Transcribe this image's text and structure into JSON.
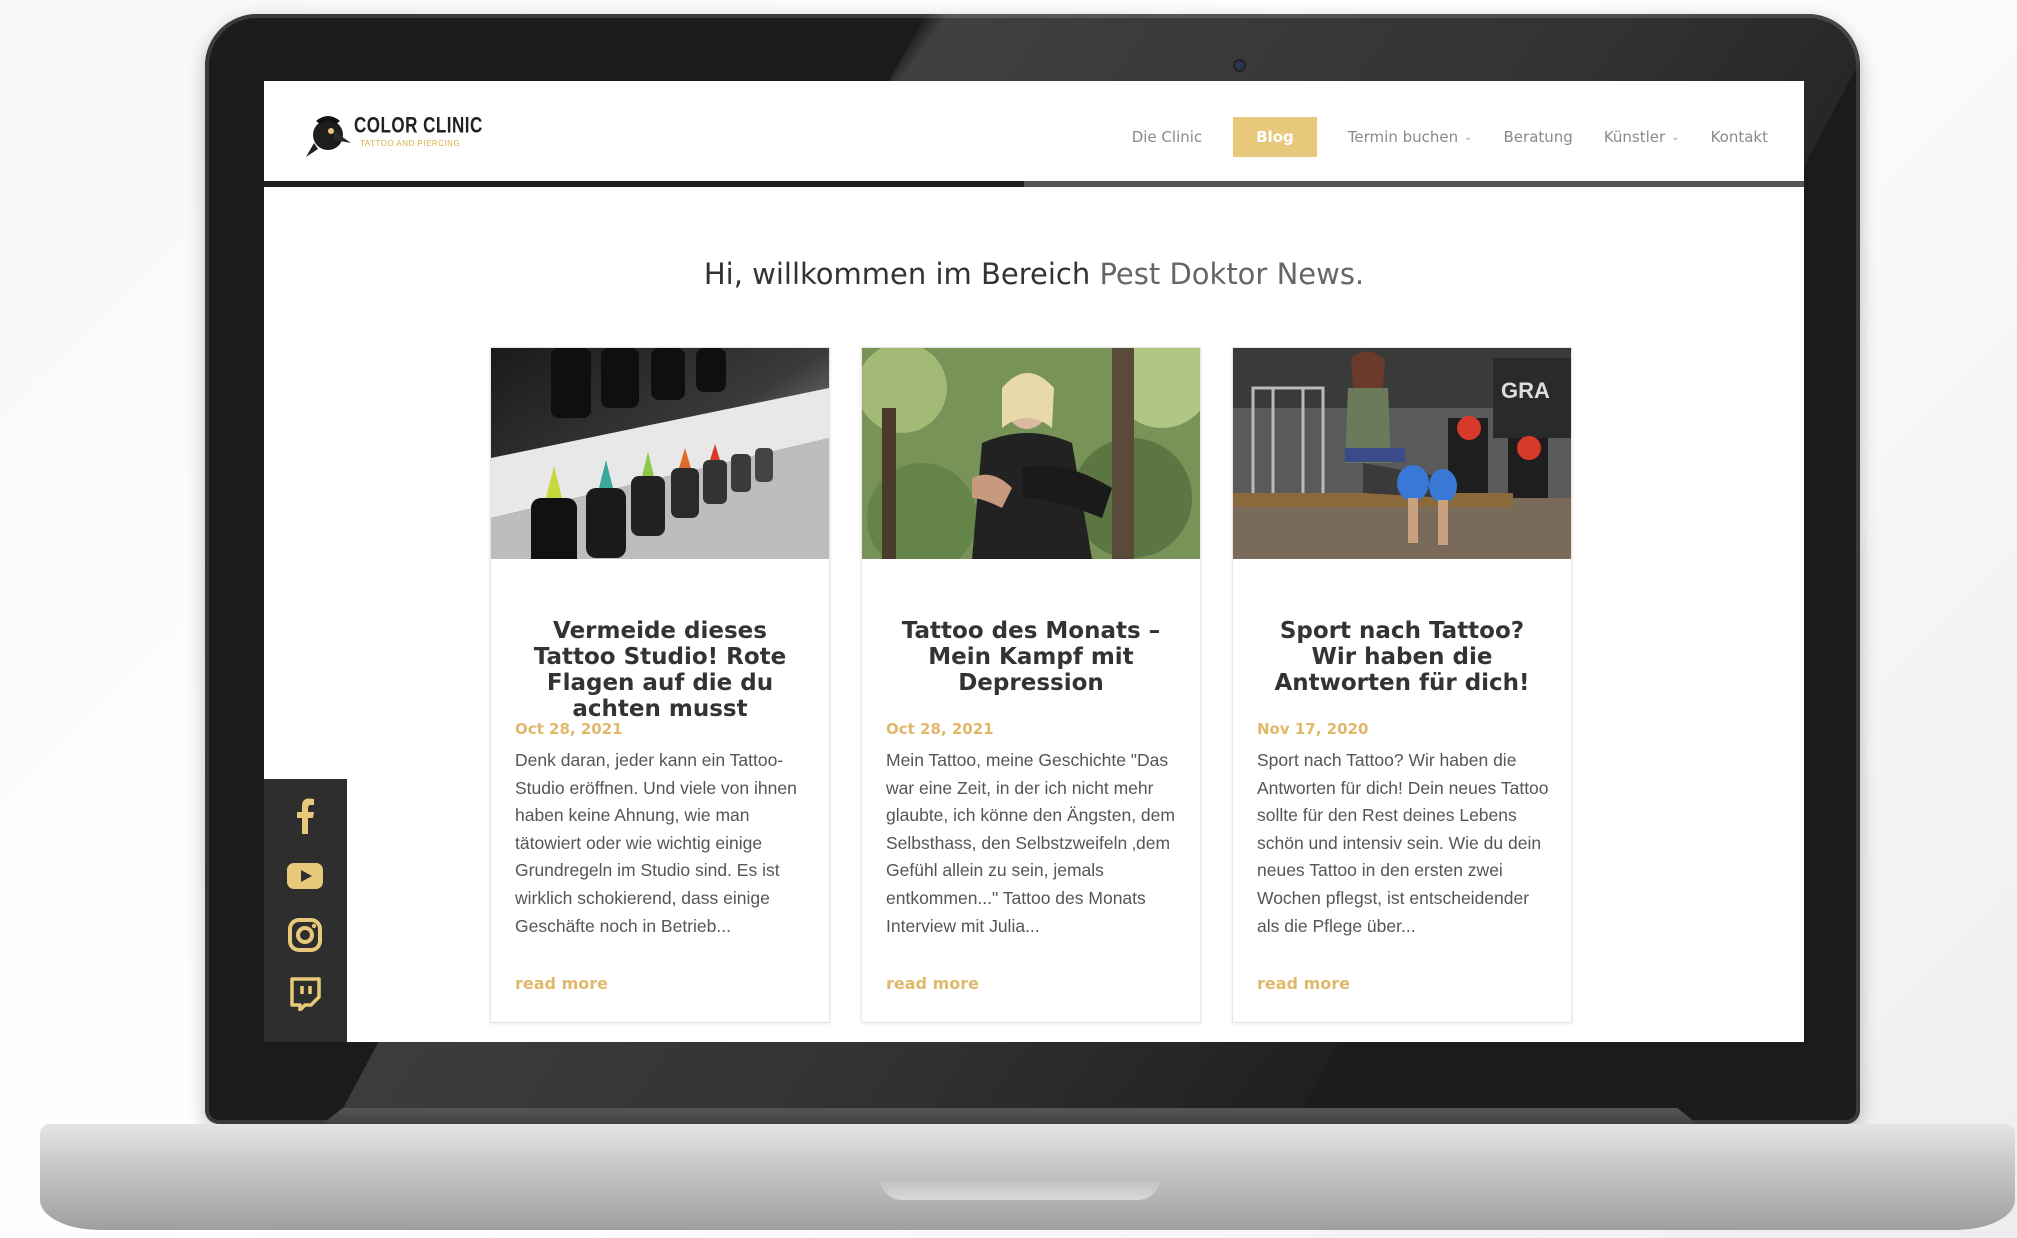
{
  "brand": {
    "logo_name": "COLOR CLINIC",
    "logo_sub": "TATTOO AND PIERCING",
    "accent": "#e8c87a"
  },
  "nav": {
    "items": [
      {
        "label": "Die Clinic",
        "dropdown": false,
        "active": false
      },
      {
        "label": "Blog",
        "dropdown": false,
        "active": true
      },
      {
        "label": "Termin buchen",
        "dropdown": true,
        "active": false
      },
      {
        "label": "Beratung",
        "dropdown": false,
        "active": false
      },
      {
        "label": "Künstler",
        "dropdown": true,
        "active": false
      },
      {
        "label": "Kontakt",
        "dropdown": false,
        "active": false
      }
    ]
  },
  "welcome": {
    "text": "Hi, willkommen im Bereich ",
    "accent": "Pest Doktor News."
  },
  "posts": [
    {
      "title": "Vermeide dieses Tattoo Studio! Rote Flagen auf die du achten musst",
      "date": "Oct 28, 2021",
      "excerpt": "Denk daran, jeder kann ein Tattoo-Studio eröffnen. Und viele von ihnen haben keine Ahnung, wie man tätowiert oder wie wichtig einige Grundregeln im Studio sind. Es ist wirklich schokierend, dass einige Geschäfte noch in Betrieb...",
      "more": "read more"
    },
    {
      "title": "Tattoo des Monats – Mein Kampf mit Depression",
      "date": "Oct 28, 2021",
      "excerpt": "Mein Tattoo, meine Geschichte \"Das war eine Zeit, in der ich nicht mehr glaubte, ich könne den Ängsten, dem Selbsthass, den Selbstzweifeln ‚dem Gefühl allein zu sein, jemals entkommen...\" Tattoo des Monats Interview mit Julia...",
      "more": "read more"
    },
    {
      "title": "Sport nach Tattoo? Wir haben die Antworten für dich!",
      "date": "Nov 17, 2020",
      "excerpt": "Sport nach Tattoo? Wir haben die Antworten für dich! Dein neues Tattoo sollte für den Rest deines Lebens schön und intensiv sein. Wie du dein neues Tattoo in den ersten zwei Wochen pflegst, ist entscheidender als die Pflege über...",
      "more": "read more"
    }
  ],
  "social": [
    "facebook-icon",
    "youtube-icon",
    "instagram-icon",
    "twitch-icon"
  ]
}
